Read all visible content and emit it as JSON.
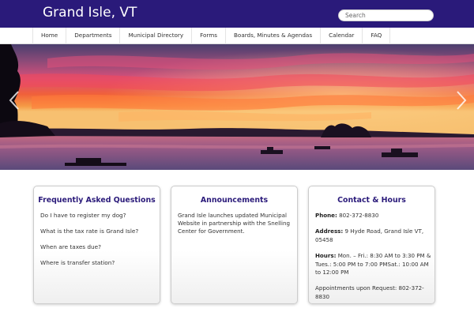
{
  "header": {
    "site_title": "Grand Isle, VT",
    "search_placeholder": "Search",
    "brand_color": "#2a1a7a"
  },
  "nav": {
    "items": [
      "Home",
      "Departments",
      "Municipal Directory",
      "Forms",
      "Boards, Minutes & Agendas",
      "Calendar",
      "FAQ"
    ]
  },
  "hero": {
    "image": "sunset-over-lake-photo",
    "prev_icon": "chevron-left-icon",
    "next_icon": "chevron-right-icon"
  },
  "faq": {
    "title": "Frequently Asked Questions",
    "items": [
      "Do I have to register my dog?",
      "What is the tax rate is Grand Isle?",
      "When are taxes due?",
      "Where is transfer station?"
    ]
  },
  "announcements": {
    "title": "Announcements",
    "text": "Grand Isle launches updated Municipal Website in partnership with the Snelling Center for Government."
  },
  "contact": {
    "title": "Contact & Hours",
    "phone_label": "Phone:",
    "phone": "802-372-8830",
    "address_label": "Address:",
    "address": "9 Hyde Road, Grand Isle VT, 05458",
    "hours_label": "Hours:",
    "hours": "Mon. – Fri.: 8:30 AM to 3:30 PM & Tues.: 5:00 PM to 7:00 PMSat.: 10:00 AM to 12:00 PM",
    "appointments": "Appointments upon Request: 802-372-8830"
  }
}
